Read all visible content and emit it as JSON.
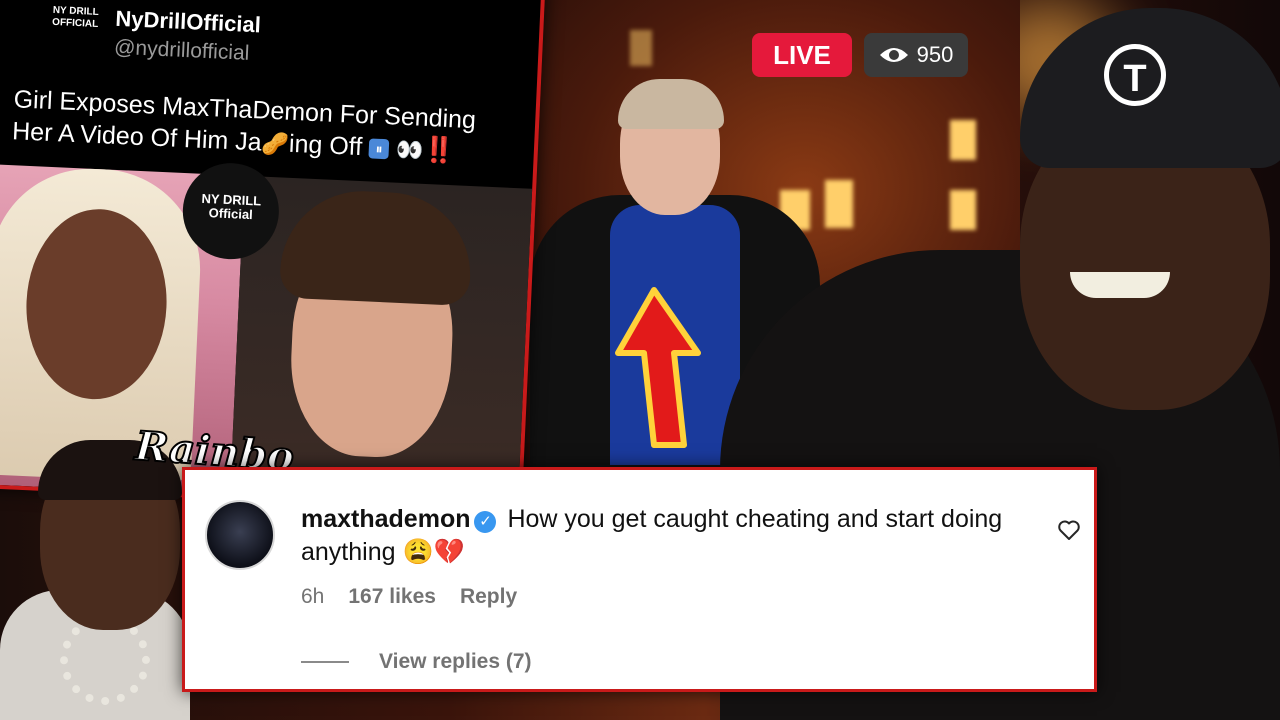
{
  "tweet": {
    "name": "NyDrillOfficial",
    "handle": "@nydrillofficial",
    "logo_text": "NY DRILL OFFICIAL",
    "text_part1": "Girl Exposes MaxThaDemon For Sending Her A Video Of Him Ja",
    "text_part2": "ing Off",
    "emoji_peanut": "🥜",
    "emoji_pause": "⏸",
    "emoji_eyes": "👀",
    "emoji_bang": "‼️",
    "badge_text": "NY DRILL Official"
  },
  "stream": {
    "live_label": "LIVE",
    "viewer_count": "950"
  },
  "overlay_script_text": "Rainbo",
  "comment": {
    "username": "maxthademon",
    "verified_mark": "✓",
    "body": "How you get caught cheating and start doing anything",
    "emoji_weary": "😩",
    "emoji_broken_heart": "💔",
    "time": "6h",
    "likes": "167 likes",
    "reply_label": "Reply",
    "view_replies": "View replies (7)"
  },
  "colors": {
    "accent_red": "#c91a1a",
    "live_red": "#e5193b",
    "verified_blue": "#3897f0",
    "meta_gray": "#737373"
  },
  "icons": [
    "eye-icon",
    "heart-icon",
    "verified-badge-icon",
    "up-arrow-icon"
  ]
}
